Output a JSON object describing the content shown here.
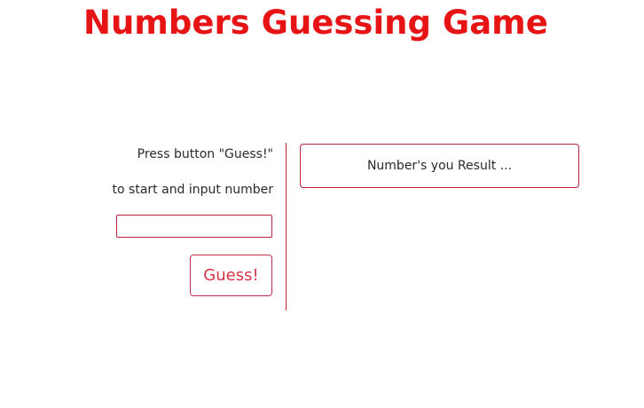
{
  "header": {
    "title": "Numbers Guessing Game"
  },
  "guess_panel": {
    "instruction_line1": "Press button \"Guess!\"",
    "instruction_line2": "to start and input number",
    "input_value": "",
    "input_placeholder": "",
    "button_label": "Guess!"
  },
  "result_panel": {
    "text": "Number's you Result ..."
  },
  "colors": {
    "accent": "#e61414",
    "border": "#b8233a",
    "button_text": "#d63448"
  }
}
